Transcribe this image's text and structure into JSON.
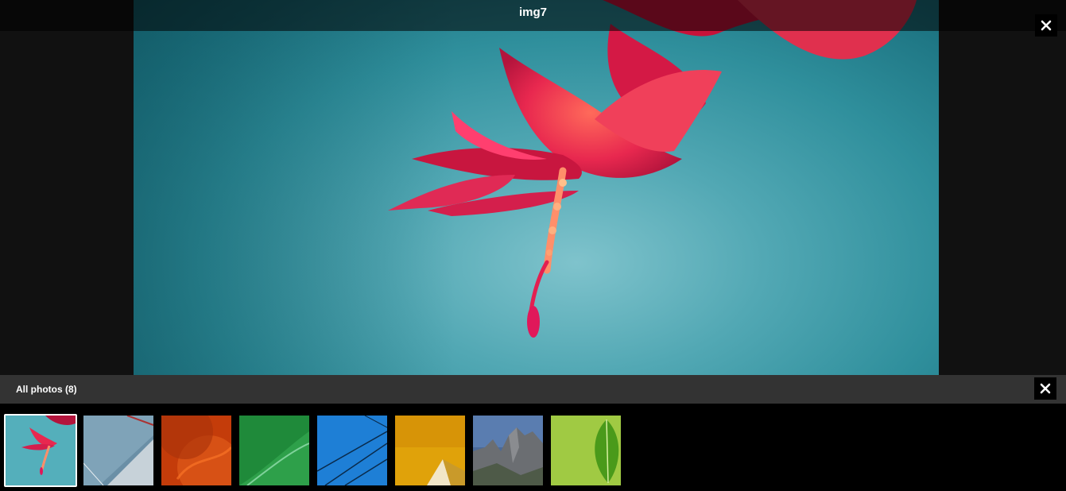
{
  "viewer": {
    "title": "img7",
    "close_label": "close"
  },
  "strip": {
    "title": "All photos (8)",
    "close_label": "close",
    "thumbnails": [
      {
        "name": "img7",
        "subject": "red-flower-on-teal",
        "selected": true
      },
      {
        "name": "thumb-2",
        "subject": "grey-blue-geometric",
        "selected": false
      },
      {
        "name": "thumb-3",
        "subject": "orange-abstract",
        "selected": false
      },
      {
        "name": "thumb-4",
        "subject": "green-curve",
        "selected": false
      },
      {
        "name": "thumb-5",
        "subject": "blue-lines",
        "selected": false
      },
      {
        "name": "thumb-6",
        "subject": "yellow-abstract",
        "selected": false
      },
      {
        "name": "thumb-7",
        "subject": "mountains",
        "selected": false
      },
      {
        "name": "thumb-8",
        "subject": "green-leaf",
        "selected": false
      }
    ]
  },
  "colors": {
    "background": "#111111",
    "strip_header": "#333333",
    "strip_background": "#000000",
    "selected_border": "#ffffff"
  }
}
